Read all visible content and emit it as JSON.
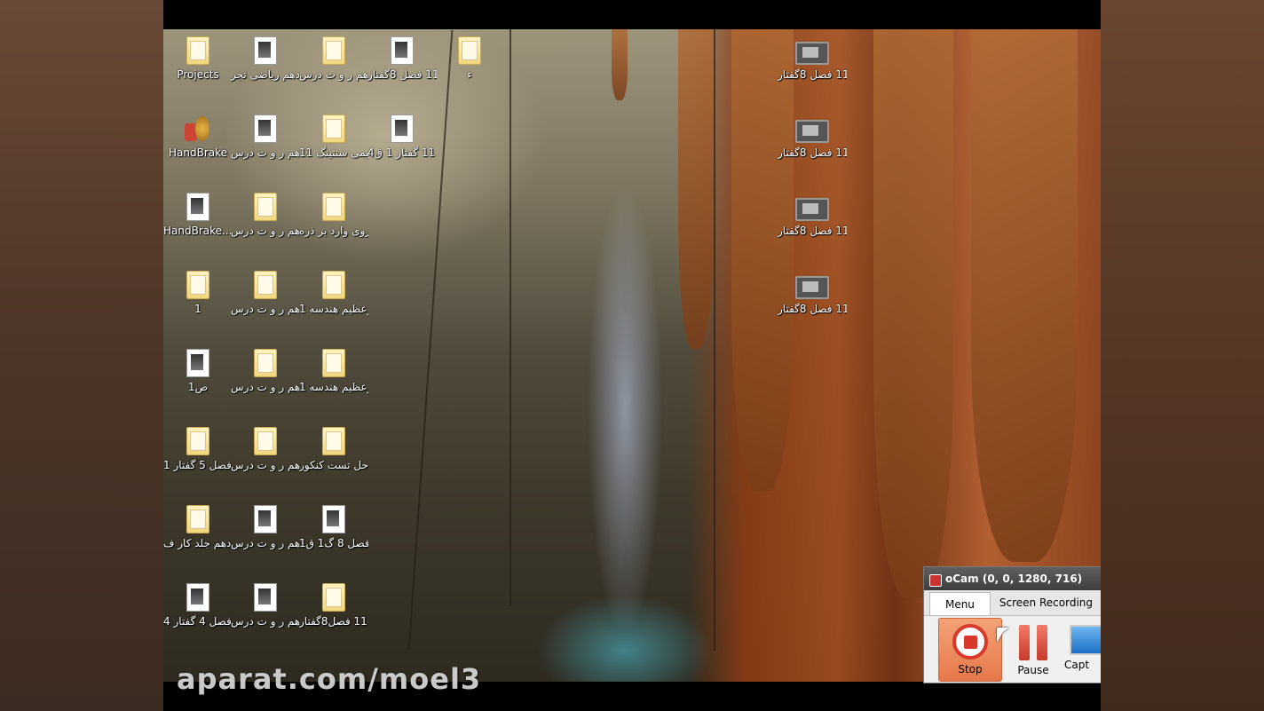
{
  "desktop": {
    "icons": [
      {
        "label": "Projects",
        "type": "folder"
      },
      {
        "label": "فارسی یازدهم ریاضی تجر...",
        "type": "doc"
      },
      {
        "label": "فارسی یازدهم ر و ت درس ...",
        "type": "folder"
      },
      {
        "label": "زیست 11 فصل 8گفتار...",
        "type": "doc"
      },
      {
        "label": "ء",
        "type": "folder"
      },
      {
        "label": "HandBrake",
        "type": "app"
      },
      {
        "label": "فارسی یازدهم ر و ت درس ...",
        "type": "doc"
      },
      {
        "label": "میراثی شیمی سنتینگ 11",
        "type": "folder"
      },
      {
        "label": "زیست 11 گفتار 1 ق4",
        "type": "doc"
      },
      {
        "label": "HandBrake....",
        "type": "doc"
      },
      {
        "label": "فارسی یازدهم ر و ت درس ...",
        "type": "folder"
      },
      {
        "label": "فیزیک 2 نیروی وارد بر ذره",
        "type": "folder"
      },
      {
        "label": "1",
        "type": "folder"
      },
      {
        "label": "فارسی یازدهم ر و ت درس ...",
        "type": "folder"
      },
      {
        "label": "میرعظیم هندسه 1...",
        "type": "folder"
      },
      {
        "label": "ص1",
        "type": "doc"
      },
      {
        "label": "فارسی یازدهم ر و ت درس ...",
        "type": "folder"
      },
      {
        "label": "میرعظیم هندسه 1...",
        "type": "folder"
      },
      {
        "label": "زیست دهم فصل 5 گفتار 1",
        "type": "folder"
      },
      {
        "label": "فارسی یازدهم ر و ت درس ...",
        "type": "folder"
      },
      {
        "label": "هندسه 11 حل تست کنکور ...",
        "type": "folder"
      },
      {
        "label": "زیست دهم جلد کار ف...",
        "type": "folder"
      },
      {
        "label": "فارسی یازدهم ر و ت درس ...",
        "type": "doc"
      },
      {
        "label": "زیست 2 فصل 8 گ1 ق1",
        "type": "doc"
      },
      {
        "label": "زیست دهم فصل 4 گفتار 4",
        "type": "doc"
      },
      {
        "label": "فارسی یازدهم ر و ت درس ...",
        "type": "doc"
      },
      {
        "label": "زیست 11 فصل8گفتار...",
        "type": "folder"
      }
    ],
    "video_icons": [
      {
        "label": "زیست 11 فصل 8گفتار..."
      },
      {
        "label": "زیست 11 فصل 8گفتار..."
      },
      {
        "label": "زیست 11 فصل 8گفتار..."
      },
      {
        "label": "زیست 11 فصل 8گفتار..."
      }
    ]
  },
  "watermark": "aparat.com/moel3",
  "ocam": {
    "title": "oCam (0, 0, 1280, 716)",
    "tabs": [
      "Menu",
      "Screen Recording"
    ],
    "buttons": {
      "stop": "Stop",
      "pause": "Pause",
      "capture": "Capt"
    }
  }
}
